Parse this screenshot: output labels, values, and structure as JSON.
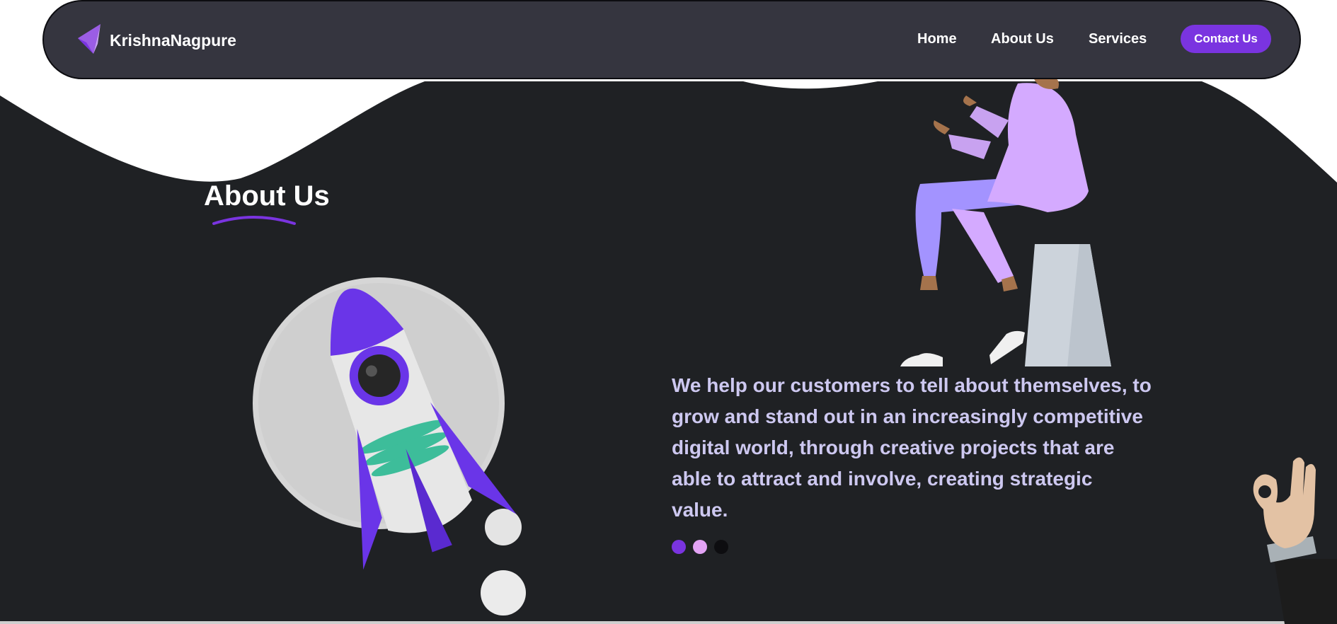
{
  "brand": {
    "name": "KrishnaNagpure",
    "logo_icon": "stacked-triangles-logo-icon"
  },
  "nav": {
    "links": [
      "Home",
      "About Us",
      "Services"
    ],
    "contact_label": "Contact Us"
  },
  "about": {
    "title": "About Us",
    "description": "We help our customers to tell about themselves, to grow and stand out in an increasingly competitive digital world, through creative projects that are able to attract and involve, creating strategic value."
  },
  "illustrations": [
    "rocket-illustration",
    "sitting-person-illustration",
    "ok-hand-illustration"
  ],
  "carousel": {
    "dot_count": 3,
    "active_index": 0
  },
  "colors": {
    "accent": "#7a34e0",
    "navbar_bg": "#35353f",
    "page_bg": "#1f2124",
    "text_light": "#cdc8f0",
    "dot_pink": "#e3a3f5",
    "dot_dark": "#0d0d10"
  }
}
